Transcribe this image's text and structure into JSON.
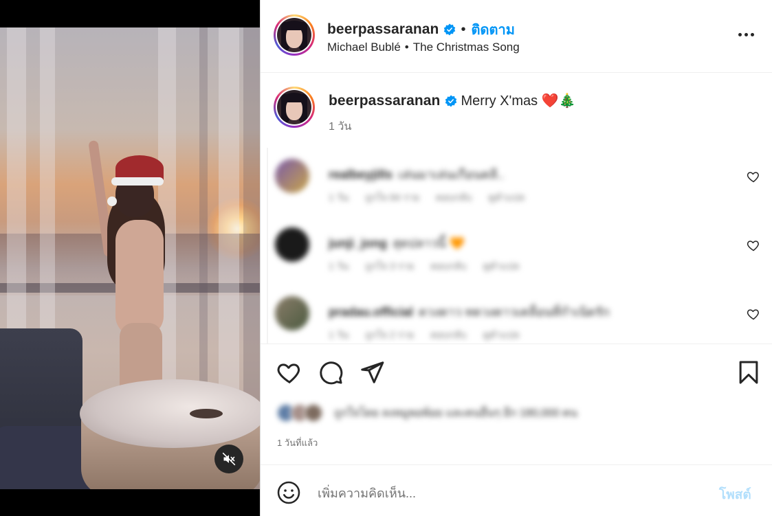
{
  "post": {
    "username": "beerpassaranan",
    "follow_label": "ติดตาม",
    "separator": "•",
    "music": {
      "artist": "Michael Bublé",
      "separator": "•",
      "song": "The Christmas Song"
    },
    "caption": "Merry X'mas ❤️🎄",
    "caption_time": "1 วัน",
    "posted_ago": "1 วันที่แล้ว"
  },
  "comments": [
    {
      "user": "realbeyjills",
      "text": "เล่นมาเล่นเกือนคลี..",
      "meta": [
        "1 วัน",
        "ถูกใจ 84 ราย",
        "ตอบกลับ",
        "ดูคำแปล"
      ]
    },
    {
      "user": "junji_jong",
      "text": "สุดปลาวนี้ 🧡",
      "meta": [
        "1 วัน",
        "ถูกใจ 3 ราย",
        "ตอบกลับ",
        "ดูคำแปล"
      ]
    },
    {
      "user": "pradau.official",
      "text": "ดวงดาว ทดวงดาวเคลื่อนที่กำเนิดรัก",
      "meta": [
        "1 วัน",
        "ถูกใจ 2 ราย",
        "ตอบกลับ",
        "ดูคำแปล"
      ]
    }
  ],
  "likes": {
    "text": "ถูกใจโดย ลงหมูพอพ้อย และคนอื่นๆ อีก 180,000 คน"
  },
  "comment_box": {
    "placeholder": "เพิ่มความคิดเห็น...",
    "post_label": "โพสต์"
  },
  "colors": {
    "accent_blue": "#0095f6",
    "post_disabled": "#b2dffc",
    "secondary_text": "#737373"
  },
  "icons": {
    "verified": "verified-badge-icon",
    "more": "more-options-icon",
    "mute": "speaker-muted-icon",
    "like": "heart-outline-icon",
    "comment": "comment-bubble-icon",
    "share": "paper-plane-icon",
    "save": "bookmark-icon",
    "emoji": "smiley-icon"
  }
}
